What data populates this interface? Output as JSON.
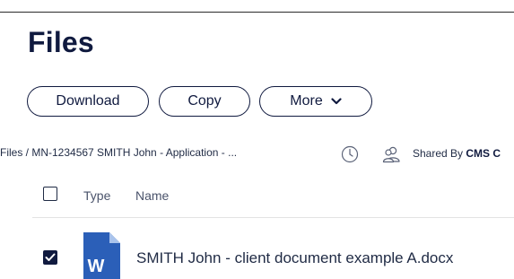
{
  "page": {
    "title": "Files"
  },
  "toolbar": {
    "download_label": "Download",
    "copy_label": "Copy",
    "more_label": "More"
  },
  "breadcrumb": {
    "text": "Files / MN-1234567 SMITH John - Application - ..."
  },
  "meta": {
    "shared_by_label": "Shared By",
    "shared_by_value": "CMS C"
  },
  "table": {
    "columns": [
      "Type",
      "Name"
    ],
    "rows": [
      {
        "type_icon": "word-document-icon",
        "type_letter": "W",
        "name": "SMITH John - client document example A.docx",
        "selected": true
      }
    ]
  },
  "colors": {
    "brand": "#101a3f",
    "word_blue": "#2b5fb8"
  },
  "icons": {
    "history": "clock-icon",
    "share": "people-icon",
    "more": "chevron-down-icon",
    "selected": "checkmark-icon"
  }
}
